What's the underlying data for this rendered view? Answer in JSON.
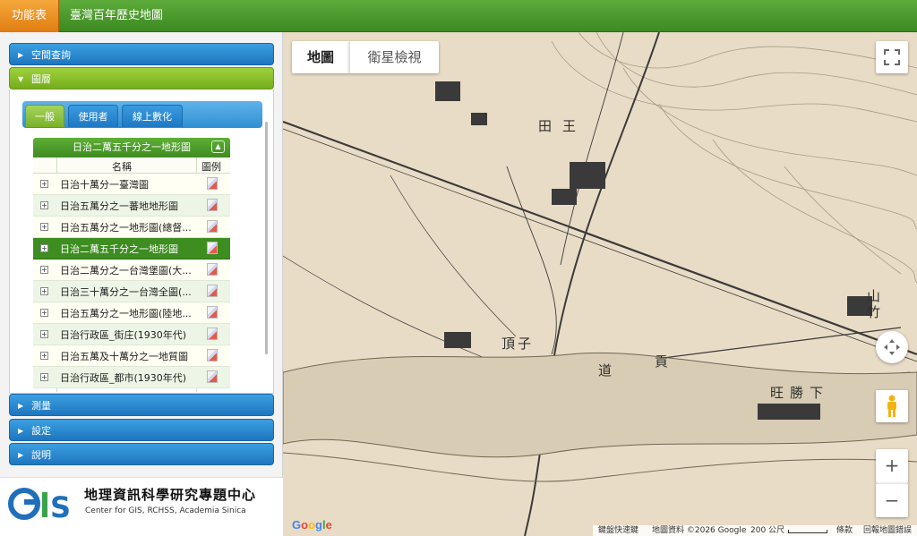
{
  "header": {
    "menu_label": "功能表",
    "title": "臺灣百年歷史地圖"
  },
  "sidebar": {
    "sections": [
      {
        "label": "空間查詢"
      },
      {
        "label": "圖層"
      },
      {
        "label": "測量"
      },
      {
        "label": "設定"
      },
      {
        "label": "說明"
      }
    ],
    "tabs": [
      {
        "label": "一般"
      },
      {
        "label": "使用者"
      },
      {
        "label": "線上數化"
      }
    ],
    "layer_group": {
      "title": "日治二萬五千分之一地形圖",
      "col_name": "名稱",
      "col_legend": "圖例",
      "rows": [
        {
          "name": "日治十萬分一臺灣圖"
        },
        {
          "name": "日治五萬分之一蕃地地形圖"
        },
        {
          "name": "日治五萬分之一地形圖(總督..."
        },
        {
          "name": "日治二萬五千分之一地形圖"
        },
        {
          "name": "日治二萬分之一台灣堡圖(大..."
        },
        {
          "name": "日治三十萬分之一台灣全圖(..."
        },
        {
          "name": "日治五萬分之一地形圖(陸地..."
        },
        {
          "name": "日治行政區_街庄(1930年代)"
        },
        {
          "name": "日治五萬及十萬分之一地質圖"
        },
        {
          "name": "日治行政區_都市(1930年代)"
        }
      ]
    },
    "logo": {
      "cn": "地理資訊科學研究專題中心",
      "en": "Center for GIS, RCHSS, Academia Sinica",
      "mark": "GIS"
    }
  },
  "map": {
    "type_buttons": [
      {
        "label": "地圖"
      },
      {
        "label": "衛星檢視"
      }
    ],
    "labels": [
      "王",
      "田",
      "竹",
      "山",
      "子",
      "頂",
      "貢",
      "道",
      "下",
      "勝",
      "旺"
    ],
    "attribution": {
      "shortcuts": "鍵盤快速鍵",
      "data": "地圖資料 ©2026 Google",
      "scale": "200 公尺",
      "terms": "條款",
      "report": "回報地圖錯誤"
    },
    "google_logo": "Google",
    "zoom_in": "+",
    "zoom_out": "−"
  },
  "colors": {
    "header_green": "#3d8a22",
    "menu_orange": "#e07d12",
    "accordion_blue": "#1d76bf",
    "accordion_green": "#74ac1c",
    "map_paper": "#e9dcc6"
  }
}
